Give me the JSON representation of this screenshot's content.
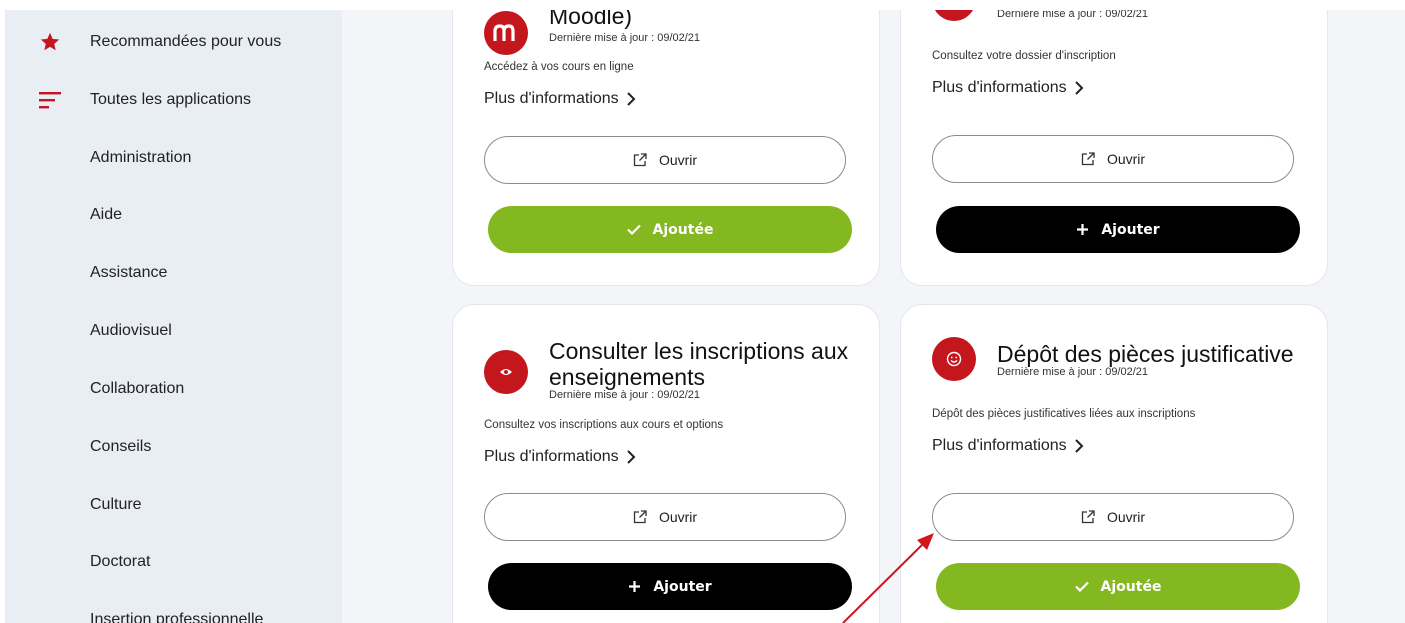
{
  "sidebar": {
    "items": [
      {
        "label": "Recommandées pour vous",
        "icon": "star-icon"
      },
      {
        "label": "Toutes les applications",
        "icon": "list-filter-icon"
      },
      {
        "label": "Administration"
      },
      {
        "label": "Aide"
      },
      {
        "label": "Assistance"
      },
      {
        "label": "Audiovisuel"
      },
      {
        "label": "Collaboration"
      },
      {
        "label": "Conseils"
      },
      {
        "label": "Culture"
      },
      {
        "label": "Doctorat"
      },
      {
        "label": "Insertion professionnelle"
      }
    ]
  },
  "cards": [
    {
      "title_lines": [
        "Moodle)"
      ],
      "updated": "Dernière mise à jour : 09/02/21",
      "description": "Accédez à vos cours en ligne",
      "more_label": "Plus d'informations",
      "open_label": "Ouvrir",
      "add_label": "Ajoutée",
      "added": true,
      "icon": "moodle-logo-icon"
    },
    {
      "title_lines": [],
      "updated": "Dernière mise à jour : 09/02/21",
      "description": "Consultez votre dossier d'inscription",
      "more_label": "Plus d'informations",
      "open_label": "Ouvrir",
      "add_label": "Ajouter",
      "added": false,
      "icon": "app-icon"
    },
    {
      "title_lines": [
        "Consulter les inscriptions aux",
        "enseignements"
      ],
      "updated": "Dernière mise à jour : 09/02/21",
      "description": "Consultez vos inscriptions aux cours et options",
      "more_label": "Plus d'informations",
      "open_label": "Ouvrir",
      "add_label": "Ajouter",
      "added": false,
      "icon": "eye-icon"
    },
    {
      "title_lines": [
        "Dépôt des pièces justificative"
      ],
      "updated": "Dernière mise à jour : 09/02/21",
      "description": "Dépôt des pièces justificatives liées aux inscriptions",
      "more_label": "Plus d'informations",
      "open_label": "Ouvrir",
      "add_label": "Ajoutée",
      "added": true,
      "icon": "smiley-icon"
    }
  ],
  "colors": {
    "accent_red": "#c3161d",
    "added_green": "#84b820",
    "add_black": "#000000",
    "annotation_arrow": "#d0161d"
  },
  "annotation": {
    "type": "arrow",
    "points_to": "card-4 open-button"
  }
}
